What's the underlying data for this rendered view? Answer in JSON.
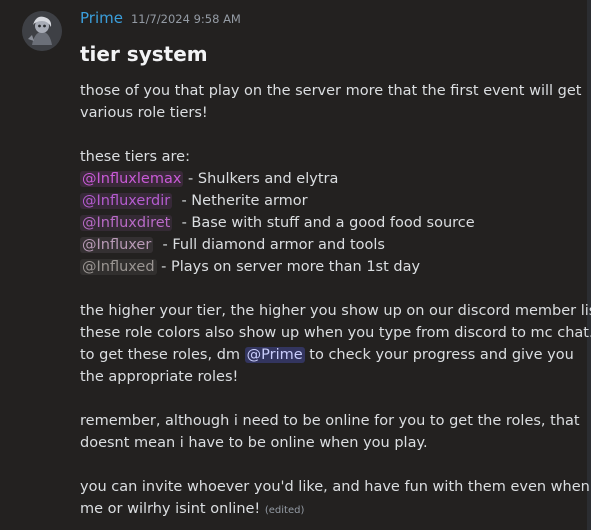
{
  "message": {
    "author": "Prime",
    "timestamp": "11/7/2024 9:58 AM",
    "title": "tier system",
    "intro_line1": "those of  you that play on the server more that the first event will get",
    "intro_line2": "various role tiers!",
    "tiers_heading": "these tiers are:",
    "tiers": [
      {
        "mention": "@Influxlemax",
        "text": " - Shulkers and elytra",
        "color": "#c85ad6"
      },
      {
        "mention": "@Influxerdir",
        "text": "  - Netherite armor",
        "color": "#b45bcf"
      },
      {
        "mention": "@Influxdiret",
        "text": "  - Base with stuff and a good food source",
        "color": "#b86ac6"
      },
      {
        "mention": "@Influxer",
        "text": "  - Full diamond armor and tools",
        "color": "#b89ab6"
      },
      {
        "mention": "@Influxed",
        "text": " - Plays on server more than 1st day",
        "color": "#9a9592"
      }
    ],
    "para2_line1": "the higher your tier, the higher you show up on our discord member list.",
    "para2_line2": "these role colors also show up when you type from discord to mc chat.",
    "para2_line3_before": "to get these roles, dm ",
    "para2_mention": "@Prime",
    "para2_line3_after": " to check your progress and give you",
    "para2_line4": "the appropriate roles!",
    "para3_line1": "remember, although i need to be online for you to get the roles, that",
    "para3_line2": "doesnt mean i have to be online when you play.",
    "para4_line1": "you can invite whoever you'd like, and have fun with them even when",
    "para4_line2": "me or wilrhy isint online!",
    "edited_label": "(edited)",
    "avatar_icon": "user-avatar-icon"
  }
}
